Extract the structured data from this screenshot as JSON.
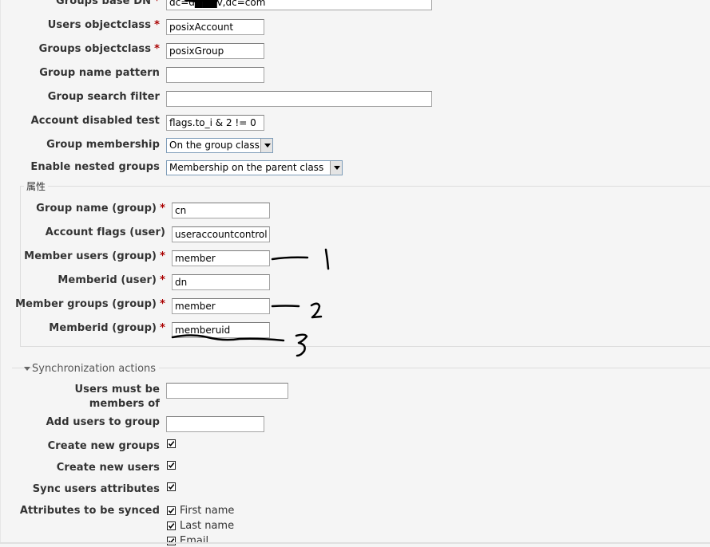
{
  "form": {
    "groups_base_dn": {
      "label": "Groups base DN",
      "value": "dc=d███v,dc=com"
    },
    "users_objectclass": {
      "label": "Users objectclass",
      "value": "posixAccount"
    },
    "groups_objectclass": {
      "label": "Groups objectclass",
      "value": "posixGroup"
    },
    "group_name_pattern": {
      "label": "Group name pattern",
      "value": ""
    },
    "group_search_filter": {
      "label": "Group search filter",
      "value": ""
    },
    "account_disabled_test": {
      "label": "Account disabled test",
      "value": "flags.to_i & 2 != 0"
    },
    "group_membership": {
      "label": "Group membership",
      "value": "On the group class"
    },
    "enable_nested_groups": {
      "label": "Enable nested groups",
      "value": "Membership on the parent class"
    }
  },
  "attributes": {
    "legend": "属性",
    "group_name": {
      "label": "Group name (group)",
      "value": "cn"
    },
    "account_flags": {
      "label": "Account flags (user)",
      "value": "useraccountcontrol"
    },
    "member_users": {
      "label": "Member users (group)",
      "value": "member"
    },
    "memberid_user": {
      "label": "Memberid (user)",
      "value": "dn"
    },
    "member_groups": {
      "label": "Member groups (group)",
      "value": "member"
    },
    "memberid_group": {
      "label": "Memberid (group)",
      "value": "memberuid"
    }
  },
  "sync": {
    "section_title": "Synchronization actions",
    "users_must_be_members_of": {
      "label": "Users must be members of",
      "value": ""
    },
    "add_users_to_group": {
      "label": "Add users to group",
      "value": ""
    },
    "create_new_groups": {
      "label": "Create new groups",
      "checked": true
    },
    "create_new_users": {
      "label": "Create new users",
      "checked": true
    },
    "sync_users_attributes": {
      "label": "Sync users attributes",
      "checked": true
    },
    "attributes_to_be_synced": {
      "label": "Attributes to be synced",
      "options": [
        {
          "label": "First name",
          "checked": true
        },
        {
          "label": "Last name",
          "checked": true
        },
        {
          "label": "Email",
          "checked": true
        }
      ]
    }
  },
  "annotations": {
    "colors": {
      "ink": "#000000"
    }
  },
  "colors": {
    "background": "#f5f5f5",
    "label_text": "#333333",
    "required_star": "#aa0000",
    "border": "#a4a4a4"
  }
}
